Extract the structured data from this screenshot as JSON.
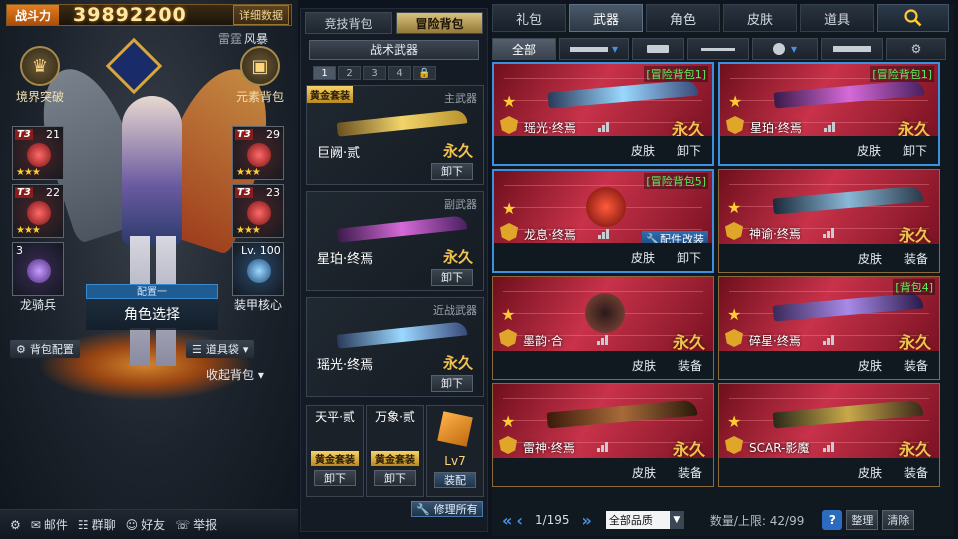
{
  "character": {
    "power_label": "战斗力",
    "power_value": "39892200",
    "detail_button": "详细数据",
    "mode_tabs": [
      "雷霆",
      "风暴"
    ],
    "realm_button": "境界突破",
    "element_button": "元素背包",
    "slots": [
      {
        "tier": "T3",
        "num": "21",
        "stars": "★★★"
      },
      {
        "tier": "T3",
        "num": "29",
        "stars": "★★★"
      },
      {
        "tier": "T3",
        "num": "22",
        "stars": "★★★"
      },
      {
        "tier": "T3",
        "num": "23",
        "stars": "★★★"
      },
      {
        "num": "3",
        "label": "龙骑兵"
      },
      {
        "num": "Lv. 100",
        "label": "装甲核心"
      }
    ],
    "config_tag": "配置一",
    "config_button": "角色选择",
    "bag_config": "背包配置",
    "item_bag": "道具袋",
    "collapse_bag": "收起背包"
  },
  "bottom_bar": {
    "mail": "邮件",
    "group_chat": "群聊",
    "friends": "好友",
    "report": "举报"
  },
  "loadout": {
    "tabs": [
      "竞技背包",
      "冒险背包"
    ],
    "active_tab": 1,
    "subtitle": "战术武器",
    "pages": [
      "1",
      "2",
      "3",
      "4",
      "🔒"
    ],
    "primary": {
      "cat": "主武器",
      "badge": "黄金套装",
      "name": "巨阙·贰",
      "perm": "永久",
      "action": "卸下"
    },
    "secondary": {
      "cat": "副武器",
      "name": "星珀·终焉",
      "perm": "永久",
      "action": "卸下"
    },
    "melee": {
      "cat": "近战武器",
      "name": "瑶光·终焉",
      "perm": "永久",
      "action": "卸下"
    },
    "mini": [
      {
        "title": "天平·贰",
        "badge": "黄金套装",
        "action": "卸下"
      },
      {
        "title": "万象·贰",
        "badge": "黄金套装",
        "action": "卸下"
      },
      {
        "title": "Lv7",
        "badge": "",
        "action": "装配"
      }
    ],
    "repair_all": "修理所有"
  },
  "warehouse": {
    "tabs": [
      "礼包",
      "武器",
      "角色",
      "皮肤",
      "道具"
    ],
    "active_tab": 1,
    "filter_all": "全部",
    "items": [
      {
        "name": "瑶光·终焉",
        "perm": "永久",
        "tag": "冒险背包1",
        "btn1": "皮肤",
        "btn2": "卸下",
        "selected": true
      },
      {
        "name": "星珀·终焉",
        "perm": "永久",
        "tag": "冒险背包1",
        "btn1": "皮肤",
        "btn2": "卸下",
        "selected": true
      },
      {
        "name": "龙息·终焉",
        "perm": "",
        "tag": "冒险背包5",
        "mod": "配件改装",
        "btn1": "皮肤",
        "btn2": "卸下",
        "selected": true
      },
      {
        "name": "神谕·终焉",
        "perm": "永久",
        "tag": "",
        "btn1": "皮肤",
        "btn2": "装备",
        "selected": false
      },
      {
        "name": "墨韵·合",
        "perm": "永久",
        "tag": "",
        "btn1": "皮肤",
        "btn2": "装备",
        "selected": false
      },
      {
        "name": "碎星·终焉",
        "perm": "永久",
        "tag": "背包4",
        "btn1": "皮肤",
        "btn2": "装备",
        "selected": false
      },
      {
        "name": "雷神·终焉",
        "perm": "永久",
        "tag": "",
        "btn1": "皮肤",
        "btn2": "装备",
        "selected": false
      },
      {
        "name": "SCAR-影魔",
        "perm": "永久",
        "tag": "",
        "btn1": "皮肤",
        "btn2": "装备",
        "selected": false
      }
    ],
    "page": "1/195",
    "quality_select": "全部品质",
    "capacity": "数量/上限: 42/99",
    "help": "?",
    "tidy": "整理",
    "clear": "清除"
  }
}
